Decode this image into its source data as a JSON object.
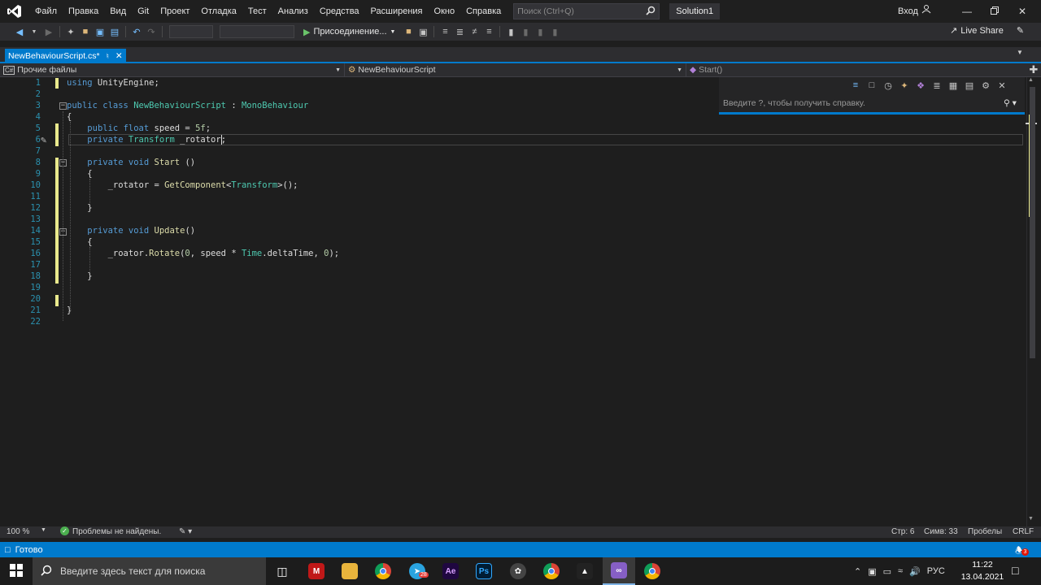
{
  "titlebar": {
    "menu": [
      "Файл",
      "Правка",
      "Вид",
      "Git",
      "Проект",
      "Отладка",
      "Тест",
      "Анализ",
      "Средства",
      "Расширения",
      "Окно",
      "Справка"
    ],
    "search_placeholder": "Поиск (Ctrl+Q)",
    "solution": "Solution1",
    "signin": "Вход"
  },
  "toolbar": {
    "attach_label": "Присоединение...",
    "liveshare_label": "Live Share"
  },
  "tab": {
    "label": "NewBehaviourScript.cs*"
  },
  "navbar": {
    "project": "Прочие файлы",
    "class": "NewBehaviourScript",
    "member": "Start()"
  },
  "quick_panel": {
    "placeholder": "Введите ?, чтобы получить справку."
  },
  "code_lines": [
    {
      "n": "1",
      "text": "using UnityEngine;"
    },
    {
      "n": "2",
      "text": ""
    },
    {
      "n": "3",
      "text": "public class NewBehaviourScript : MonoBehaviour"
    },
    {
      "n": "4",
      "text": "{"
    },
    {
      "n": "5",
      "text": "    public float speed = 5f;"
    },
    {
      "n": "6",
      "text": "    private Transform _rotator;"
    },
    {
      "n": "7",
      "text": ""
    },
    {
      "n": "8",
      "text": "    private void Start ()"
    },
    {
      "n": "9",
      "text": "    {"
    },
    {
      "n": "10",
      "text": "        _rotator = GetComponent<Transform>();"
    },
    {
      "n": "11",
      "text": ""
    },
    {
      "n": "12",
      "text": "    }"
    },
    {
      "n": "13",
      "text": ""
    },
    {
      "n": "14",
      "text": "    private void Update()"
    },
    {
      "n": "15",
      "text": "    {"
    },
    {
      "n": "16",
      "text": "        _roator.Rotate(0, speed * Time.deltaTime, 0);"
    },
    {
      "n": "17",
      "text": ""
    },
    {
      "n": "18",
      "text": "    }"
    },
    {
      "n": "19",
      "text": ""
    },
    {
      "n": "20",
      "text": ""
    },
    {
      "n": "21",
      "text": "}"
    },
    {
      "n": "22",
      "text": ""
    }
  ],
  "editor_status": {
    "zoom": "100 %",
    "problems": "Проблемы не найдены.",
    "line": "Стр: 6",
    "col": "Симв: 33",
    "whitespace": "Пробелы",
    "eol": "CRLF"
  },
  "statusbar": {
    "ready": "Готово",
    "notifications": "3"
  },
  "taskbar": {
    "search_placeholder": "Введите здесь текст для поиска",
    "badge": "28",
    "lang": "РУС",
    "time": "11:22",
    "date": "13.04.2021"
  },
  "colors": {
    "accent": "#007acc",
    "keyword": "#569cd6",
    "type": "#4ec9b0",
    "method": "#dcdcaa",
    "number": "#b5cea8",
    "vs_purple": "#865fc5"
  }
}
